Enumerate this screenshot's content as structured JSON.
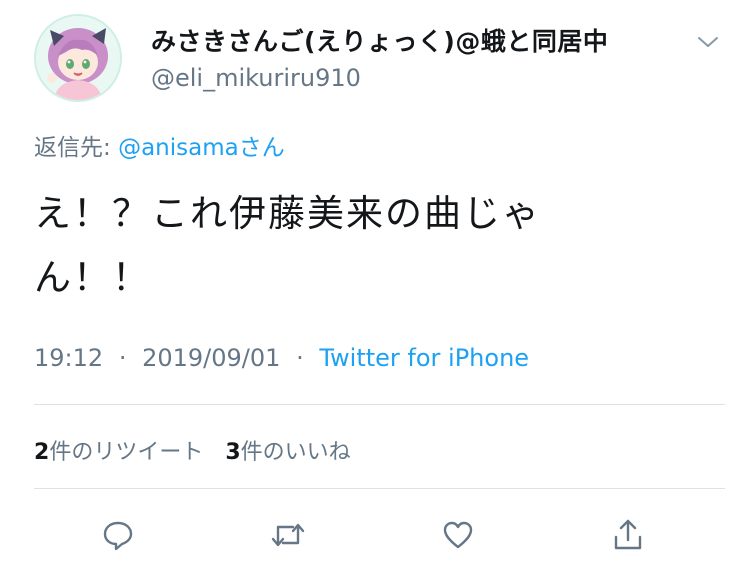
{
  "user": {
    "display_name": "みさきさんご(えりょっく)@蛾と同居中",
    "handle": "@eli_mikuriru910"
  },
  "reply": {
    "prefix": "返信先: ",
    "mention": "@anisama",
    "suffix": "さん"
  },
  "tweet": {
    "text": "え！？これ伊藤美来の曲じゃん！！"
  },
  "meta": {
    "time": "19:12",
    "separator1": "·",
    "date": "2019/09/01",
    "separator2": "·",
    "source": "Twitter for iPhone"
  },
  "stats": {
    "retweet_count": "2",
    "retweet_label": "件のリツイート",
    "like_count": "3",
    "like_label": "件のいいね"
  },
  "colors": {
    "accent": "#1da1f2",
    "muted": "#657786",
    "text": "#14171a",
    "divider": "#dce3e8"
  },
  "icons": {
    "menu": "chevron-down-icon",
    "reply": "reply-icon",
    "retweet": "retweet-icon",
    "like": "heart-icon",
    "share": "share-icon"
  }
}
